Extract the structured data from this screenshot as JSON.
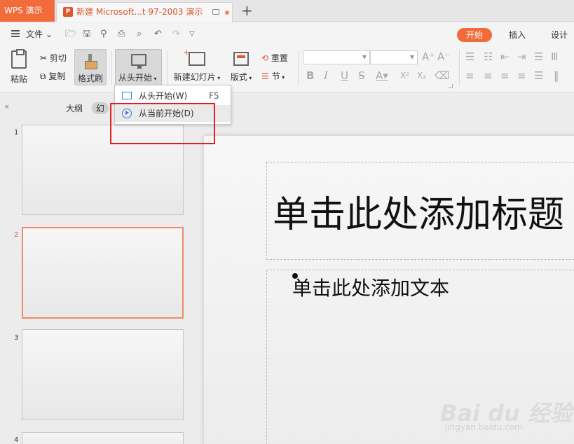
{
  "titlebar": {
    "app_tab": "WPS 演示",
    "doc_tab": "新建 Microsoft...t 97-2003 演示",
    "new_tab_glyph": "+"
  },
  "quickbar": {
    "file_menu": "文件",
    "tabs": [
      {
        "label": "开始",
        "active": true
      },
      {
        "label": "插入",
        "active": false
      },
      {
        "label": "设计",
        "active": false
      }
    ]
  },
  "ribbon": {
    "paste": "粘贴",
    "cut": "剪切",
    "copy": "复制",
    "format_painter": "格式刷",
    "start_from_beginning": "从头开始",
    "new_slide": "新建幻灯片",
    "layout": "版式",
    "reset": "重置",
    "section": "节"
  },
  "dropdown": {
    "items": [
      {
        "label": "从头开始(W)",
        "shortcut": "F5",
        "icon": "projector-icon"
      },
      {
        "label": "从当前开始(D)",
        "shortcut": "",
        "icon": "play-circle-icon"
      }
    ]
  },
  "leftpane": {
    "collapse_glyph": "«",
    "tab_outline": "大纲",
    "tab_slides": "幻",
    "thumbnails": [
      {
        "number": "1",
        "selected": false
      },
      {
        "number": "2",
        "selected": true
      },
      {
        "number": "3",
        "selected": false
      },
      {
        "number": "4",
        "selected": false
      }
    ]
  },
  "slide": {
    "title_placeholder": "单击此处添加标题",
    "body_placeholder": "单击此处添加文本"
  },
  "watermark": {
    "logo_text": "Bai du 经验",
    "url": "jingyan.baidu.com"
  },
  "colors": {
    "accent": "#f26b3a",
    "highlight_box": "#e02020",
    "selected_thumb_border": "#f08a6a"
  }
}
